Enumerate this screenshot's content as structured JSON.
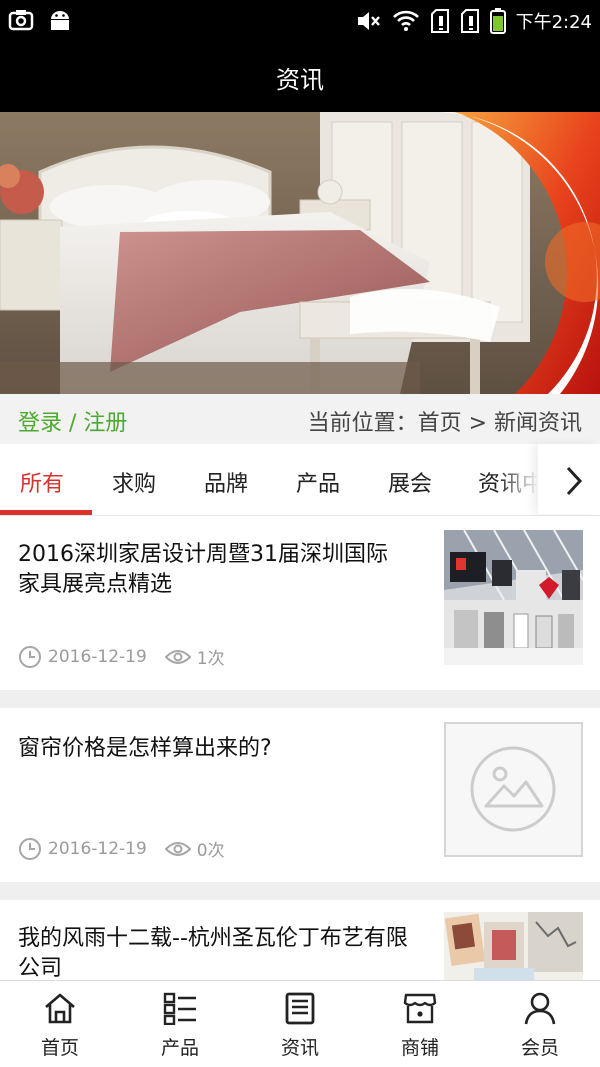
{
  "status_bar": {
    "time": "下午2:24",
    "icons": [
      "screenshot-icon",
      "android-icon",
      "mute-icon",
      "wifi-icon",
      "sim1-icon",
      "sim2-icon",
      "battery-icon"
    ]
  },
  "header": {
    "title": "资讯"
  },
  "login": {
    "label": "登录 / 注册"
  },
  "breadcrumb": {
    "text": "当前位置：首页 > 新闻资讯"
  },
  "tabs": [
    {
      "label": "所有",
      "active": true
    },
    {
      "label": "求购",
      "active": false
    },
    {
      "label": "品牌",
      "active": false
    },
    {
      "label": "产品",
      "active": false
    },
    {
      "label": "展会",
      "active": false
    },
    {
      "label": "资讯中",
      "active": false
    }
  ],
  "news": [
    {
      "title": "2016深圳家居设计周暨31届深圳国际家具展亮点精选",
      "date": "2016-12-19",
      "views": "1次",
      "thumb": "expo-photo"
    },
    {
      "title": "窗帘价格是怎样算出来的?",
      "date": "2016-12-19",
      "views": "0次",
      "thumb": "placeholder-image"
    },
    {
      "title": "我的风雨十二载--杭州圣瓦伦丁布艺有限公司",
      "date": "",
      "views": "",
      "thumb": "fabric-photo"
    }
  ],
  "bottom_nav": [
    {
      "label": "首页",
      "icon": "home-icon"
    },
    {
      "label": "产品",
      "icon": "list-icon"
    },
    {
      "label": "资讯",
      "icon": "news-icon"
    },
    {
      "label": "商铺",
      "icon": "shop-icon"
    },
    {
      "label": "会员",
      "icon": "user-icon"
    }
  ],
  "colors": {
    "accent": "#d8322f",
    "login_green": "#4caa2e",
    "status_bar": "#000000"
  }
}
